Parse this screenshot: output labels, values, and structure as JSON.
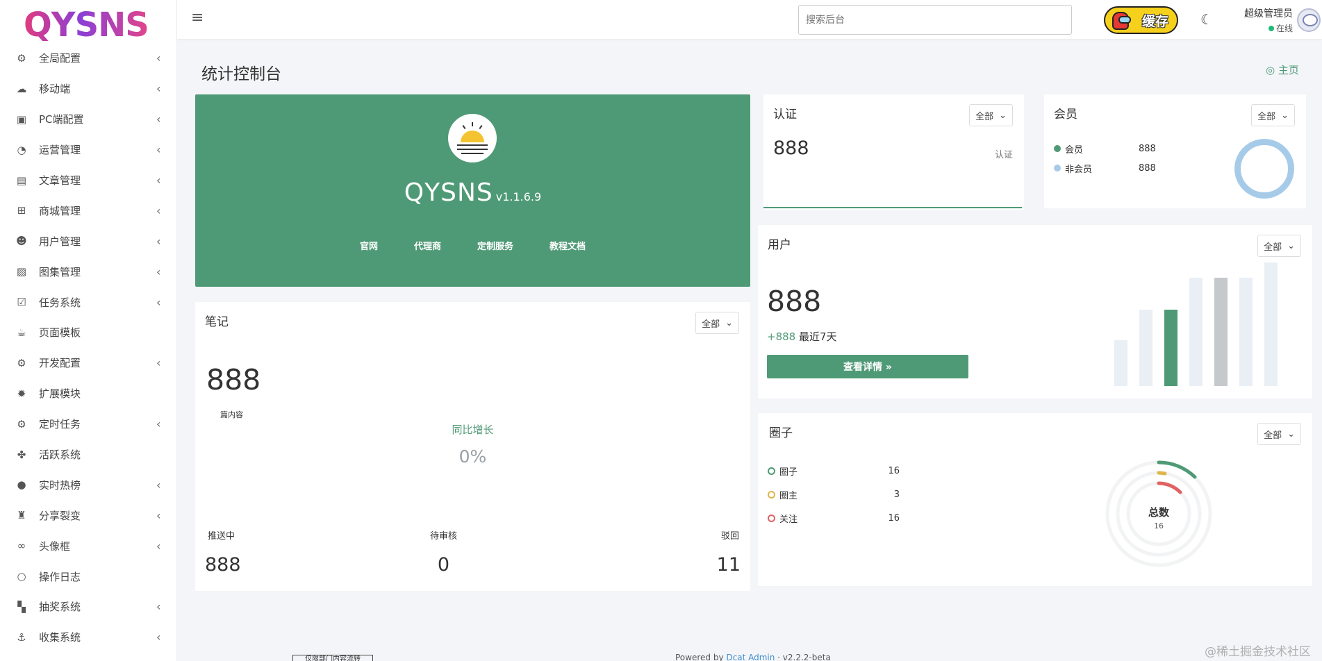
{
  "logo": {
    "text": "QYSNS"
  },
  "sidebar": {
    "items": [
      {
        "label": "全局配置",
        "icon": "gear-icon",
        "glyph": "⚙",
        "chevron": true
      },
      {
        "label": "移动端",
        "icon": "wechat-icon",
        "glyph": "☁",
        "chevron": true
      },
      {
        "label": "PC端配置",
        "icon": "vr-headset-icon",
        "glyph": "▣",
        "chevron": true
      },
      {
        "label": "运营管理",
        "icon": "pie-chart-icon",
        "glyph": "◔",
        "chevron": true
      },
      {
        "label": "文章管理",
        "icon": "book-icon",
        "glyph": "▤",
        "chevron": true
      },
      {
        "label": "商城管理",
        "icon": "cart-icon",
        "glyph": "⊞",
        "chevron": true
      },
      {
        "label": "用户管理",
        "icon": "users-icon",
        "glyph": "☻",
        "chevron": true
      },
      {
        "label": "图集管理",
        "icon": "image-icon",
        "glyph": "▨",
        "chevron": true
      },
      {
        "label": "任务系统",
        "icon": "checkbox-icon",
        "glyph": "☑",
        "chevron": true
      },
      {
        "label": "页面模板",
        "icon": "coffee-icon",
        "glyph": "☕",
        "chevron": false
      },
      {
        "label": "开发配置",
        "icon": "cog-outline-icon",
        "glyph": "⚙",
        "chevron": true
      },
      {
        "label": "扩展模块",
        "icon": "gear-solid-icon",
        "glyph": "✹",
        "chevron": false
      },
      {
        "label": "定时任务",
        "icon": "gears-icon",
        "glyph": "⚙",
        "chevron": true
      },
      {
        "label": "活跃系统",
        "icon": "paw-icon",
        "glyph": "✤",
        "chevron": false
      },
      {
        "label": "实时热榜",
        "icon": "bomb-icon",
        "glyph": "●",
        "chevron": true
      },
      {
        "label": "分享裂变",
        "icon": "sitemap-icon",
        "glyph": "♜",
        "chevron": true
      },
      {
        "label": "头像框",
        "icon": "binoculars-icon",
        "glyph": "∞",
        "chevron": true
      },
      {
        "label": "操作日志",
        "icon": "circle-notch-icon",
        "glyph": "○",
        "chevron": false
      },
      {
        "label": "抽奖系统",
        "icon": "chess-board-icon",
        "glyph": "▚",
        "chevron": true
      },
      {
        "label": "收集系统",
        "icon": "anchor-icon",
        "glyph": "⚓",
        "chevron": true
      }
    ]
  },
  "topbar": {
    "search_placeholder": "搜索后台",
    "cache_label": "缓存",
    "admin_name": "超级管理员",
    "admin_status": "在线"
  },
  "page": {
    "title": "统计控制台",
    "home_link": "主页"
  },
  "banner": {
    "name": "QYSNS",
    "version": "v1.1.6.9",
    "links": [
      "官网",
      "代理商",
      "定制服务",
      "教程文档"
    ]
  },
  "renzheng": {
    "title": "认证",
    "filter": "全部",
    "value": "888",
    "label": "认证"
  },
  "huiyuan": {
    "title": "会员",
    "filter": "全部",
    "rows": [
      {
        "label": "会员",
        "value": "888",
        "color": "#4f9a76"
      },
      {
        "label": "非会员",
        "value": "888",
        "color": "#a6cbe9"
      }
    ]
  },
  "yonghu": {
    "title": "用户",
    "filter": "全部",
    "value": "888",
    "delta": "+888",
    "delta_label": "最近7天",
    "button": "查看详情 »",
    "bar_colors": {
      "light": "#e9eff5",
      "accent": "#4f9a76",
      "gray": "#c5c9cc"
    }
  },
  "biji": {
    "title": "笔记",
    "filter": "全部",
    "value": "888",
    "sub": "篇内容",
    "growth_label": "同比增长",
    "growth_value": "0%",
    "stats": [
      {
        "label": "推送中",
        "value": "888"
      },
      {
        "label": "待审核",
        "value": "0"
      },
      {
        "label": "驳回",
        "value": "11"
      }
    ]
  },
  "quanzi": {
    "title": "圈子",
    "filter": "全部",
    "rows": [
      {
        "label": "圈子",
        "value": "16",
        "color": "#4f9a76"
      },
      {
        "label": "圈主",
        "value": "3",
        "color": "#e0b54a"
      },
      {
        "label": "关注",
        "value": "16",
        "color": "#e06262"
      }
    ],
    "total_label": "总数",
    "total_value": "16"
  },
  "footer": {
    "prefix": "Powered by ",
    "link": "Dcat Admin",
    "suffix": " · v2.2.2-beta",
    "draft": "仅限部门内容流转"
  },
  "watermark": "@稀土掘金技术社区"
}
